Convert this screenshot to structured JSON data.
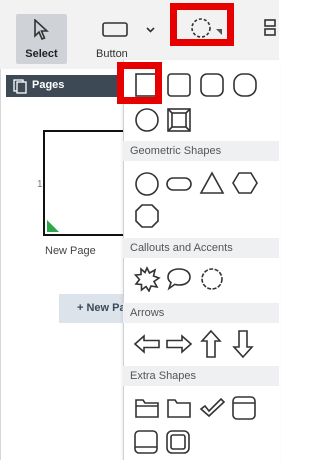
{
  "toolbar": {
    "select_label": "Select",
    "button_label": "Button"
  },
  "pages_panel": {
    "header_label": "Pages",
    "page_number": "1",
    "page_name": "New Page",
    "new_page_label": "+ New Page"
  },
  "shapes_dropdown": {
    "sections": [
      {
        "label": "Geometric Shapes"
      },
      {
        "label": "Callouts and Accents"
      },
      {
        "label": "Arrows"
      },
      {
        "label": "Extra Shapes"
      }
    ]
  },
  "colors": {
    "highlight_red": "#e60000",
    "panel_header": "#3d4a56",
    "page_corner_green": "#2aa84a"
  }
}
